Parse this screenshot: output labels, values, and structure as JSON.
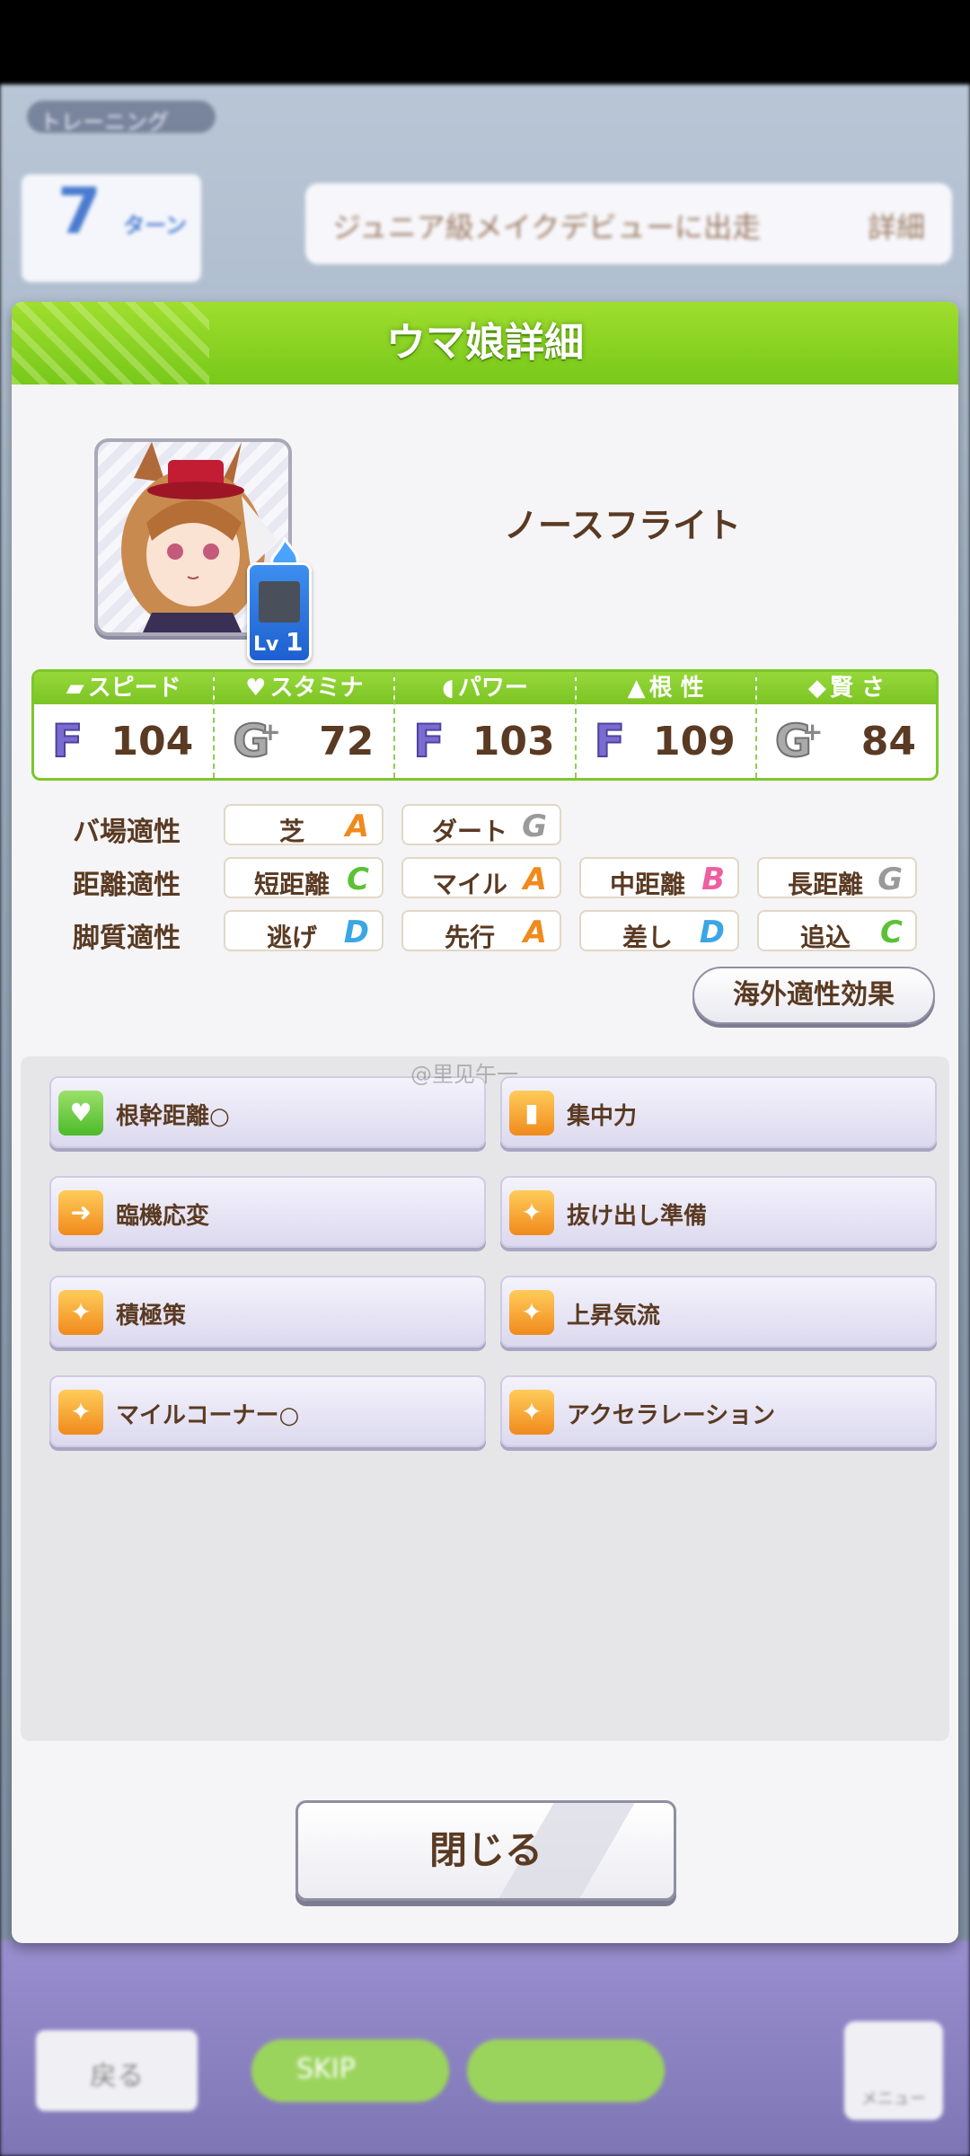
{
  "background": {
    "screen_title": "トレーニング",
    "turn_number": "7",
    "turn_unit": "ターン",
    "goal_text": "ジュニア級メイクデビューに出走",
    "goal_detail": "詳細",
    "back_label": "戻る",
    "skip_label": "SKIP",
    "menu_label": "メニュー"
  },
  "dialog": {
    "title": "ウマ娘詳細",
    "character_name": "ノースフライト",
    "level_prefix": "Lv",
    "level_value": "1",
    "stats": [
      {
        "label": "スピード",
        "icon": "shoe-icon",
        "grade": "F",
        "value": "104"
      },
      {
        "label": "スタミナ",
        "icon": "heart-icon",
        "grade": "G",
        "value": "72"
      },
      {
        "label": "パワー",
        "icon": "muscle-icon",
        "grade": "F",
        "value": "103"
      },
      {
        "label": "根 性",
        "icon": "flame-icon",
        "grade": "F",
        "value": "109"
      },
      {
        "label": "賢 さ",
        "icon": "graduation-cap-icon",
        "grade": "G",
        "value": "84"
      }
    ],
    "aptitude": {
      "track": {
        "label": "バ場適性",
        "items": [
          {
            "name": "芝",
            "rank": "A"
          },
          {
            "name": "ダート",
            "rank": "G"
          }
        ]
      },
      "distance": {
        "label": "距離適性",
        "items": [
          {
            "name": "短距離",
            "rank": "C"
          },
          {
            "name": "マイル",
            "rank": "A"
          },
          {
            "name": "中距離",
            "rank": "B"
          },
          {
            "name": "長距離",
            "rank": "G"
          }
        ]
      },
      "style": {
        "label": "脚質適性",
        "items": [
          {
            "name": "逃げ",
            "rank": "D"
          },
          {
            "name": "先行",
            "rank": "A"
          },
          {
            "name": "差し",
            "rank": "D"
          },
          {
            "name": "追込",
            "rank": "C"
          }
        ]
      }
    },
    "overseas_button": "海外適性効果",
    "skills": [
      {
        "label": "根幹距離○",
        "icon": "heart-icon"
      },
      {
        "label": "集中力",
        "icon": "gate-icon"
      },
      {
        "label": "臨機応変",
        "icon": "card-arrow-icon"
      },
      {
        "label": "抜け出し準備",
        "icon": "runner-icon"
      },
      {
        "label": "積極策",
        "icon": "runner-icon"
      },
      {
        "label": "上昇気流",
        "icon": "runner-icon"
      },
      {
        "label": "マイルコーナー○",
        "icon": "runner-icon"
      },
      {
        "label": "アクセラレーション",
        "icon": "runner-icon"
      }
    ],
    "watermark": "@里见午一",
    "close_button": "閉じる"
  },
  "colors": {
    "header_green": "#78c81a",
    "text_brown": "#5a3a22",
    "rank_A": "#f08a1c",
    "rank_B": "#ee5fa0",
    "rank_C": "#5bc238",
    "rank_D": "#3aa6e6",
    "rank_G": "#9a9a9a"
  }
}
